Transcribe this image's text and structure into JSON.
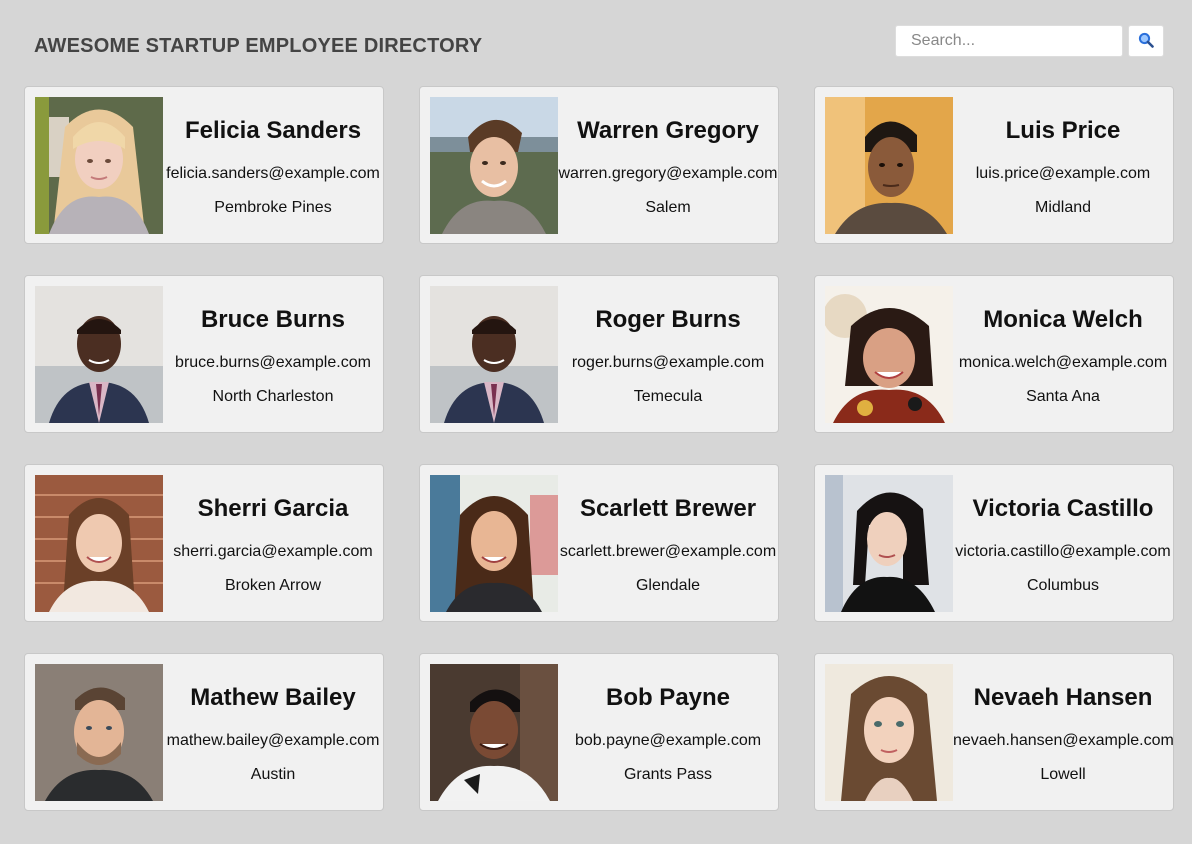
{
  "header": {
    "title": "AWESOME STARTUP EMPLOYEE DIRECTORY",
    "search_placeholder": "Search...",
    "search_button_icon": "search-icon"
  },
  "employees": [
    {
      "name": "Felicia Sanders",
      "email": "felicia.sanders@example.com",
      "city": "Pembroke Pines"
    },
    {
      "name": "Warren Gregory",
      "email": "warren.gregory@example.com",
      "city": "Salem"
    },
    {
      "name": "Luis Price",
      "email": "luis.price@example.com",
      "city": "Midland"
    },
    {
      "name": "Bruce Burns",
      "email": "bruce.burns@example.com",
      "city": "North Charleston"
    },
    {
      "name": "Roger Burns",
      "email": "roger.burns@example.com",
      "city": "Temecula"
    },
    {
      "name": "Monica Welch",
      "email": "monica.welch@example.com",
      "city": "Santa Ana"
    },
    {
      "name": "Sherri Garcia",
      "email": "sherri.garcia@example.com",
      "city": "Broken Arrow"
    },
    {
      "name": "Scarlett Brewer",
      "email": "scarlett.brewer@example.com",
      "city": "Glendale"
    },
    {
      "name": "Victoria Castillo",
      "email": "victoria.castillo@example.com",
      "city": "Columbus"
    },
    {
      "name": "Mathew Bailey",
      "email": "mathew.bailey@example.com",
      "city": "Austin"
    },
    {
      "name": "Bob Payne",
      "email": "bob.payne@example.com",
      "city": "Grants Pass"
    },
    {
      "name": "Nevaeh Hansen",
      "email": "nevaeh.hansen@example.com",
      "city": "Lowell"
    }
  ],
  "colors": {
    "page_background": "#d6d6d6",
    "card_background": "#f1f1f1",
    "title_text": "#444444",
    "search_icon": "#2a6fdb"
  }
}
